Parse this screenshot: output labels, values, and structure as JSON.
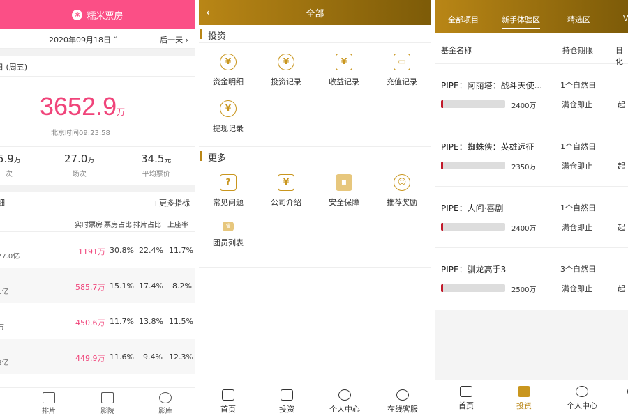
{
  "accent": {
    "pink": "#fb4f86",
    "gold": "#b98616",
    "red": "#c21a2b"
  },
  "p1": {
    "app_title": "糯米票房",
    "logo_icon": "film-reel-icon",
    "date": "2020年09月18日",
    "next_day": "后一天",
    "today_label": "日 (周五)",
    "total_value": "3652.9",
    "total_unit": "万",
    "time": "北京时间09:23:58",
    "stats": [
      {
        "value": "5.9",
        "unit": "万",
        "label": "次"
      },
      {
        "value": "27.0",
        "unit": "万",
        "label": "场次"
      },
      {
        "value": "34.5",
        "unit": "元",
        "label": "平均票价"
      }
    ],
    "detail_title": "细",
    "more_metrics": "+更多指标",
    "table_headers": [
      "实时票房",
      "票房占比",
      "排片占比",
      "上座率"
    ],
    "rows": [
      {
        "total": "27.0亿",
        "box": "1191万",
        "share": "30.8%",
        "sched": "22.4%",
        "seat": "11.7%"
      },
      {
        "total": "1亿",
        "box": "585.7万",
        "share": "15.1%",
        "sched": "17.4%",
        "seat": "8.2%"
      },
      {
        "total": "万",
        "box": "450.6万",
        "share": "11.7%",
        "sched": "13.8%",
        "seat": "11.5%"
      },
      {
        "total": "8亿",
        "box": "449.9万",
        "share": "11.6%",
        "sched": "9.4%",
        "seat": "12.3%"
      }
    ],
    "tabs": [
      {
        "label": "排片",
        "icon": "calendar-icon"
      },
      {
        "label": "影院",
        "icon": "cinema-icon"
      },
      {
        "label": "影库",
        "icon": "film-reel-icon"
      }
    ]
  },
  "p2": {
    "title": "全部",
    "back_icon": "chevron-left-icon",
    "section1": "投资",
    "section1_items": [
      {
        "label": "资金明细",
        "icon": "yen-coin-icon"
      },
      {
        "label": "投资记录",
        "icon": "yen-plus-icon"
      },
      {
        "label": "收益记录",
        "icon": "wallet-icon"
      },
      {
        "label": "充值记录",
        "icon": "card-icon"
      },
      {
        "label": "提现记录",
        "icon": "yen-withdraw-icon"
      }
    ],
    "section2": "更多",
    "section2_items": [
      {
        "label": "常见问题",
        "icon": "question-icon"
      },
      {
        "label": "公司介绍",
        "icon": "house-yen-icon"
      },
      {
        "label": "安全保障",
        "icon": "lock-icon"
      },
      {
        "label": "推荐奖励",
        "icon": "users-icon"
      },
      {
        "label": "团员列表",
        "icon": "crown-icon"
      }
    ],
    "tabs": [
      {
        "label": "首页",
        "icon": "home-icon"
      },
      {
        "label": "投资",
        "icon": "chart-line-icon"
      },
      {
        "label": "个人中心",
        "icon": "user-icon"
      },
      {
        "label": "在线客服",
        "icon": "headset-icon"
      }
    ]
  },
  "p3": {
    "nav": [
      "全部项目",
      "新手体验区",
      "精选区",
      "V"
    ],
    "active_nav": 1,
    "columns": [
      "基金名称",
      "持仓期限",
      "日化"
    ],
    "funds": [
      {
        "name": "PIPE：阿丽塔：战斗天使...",
        "period": "1个自然日",
        "progress": 0.03,
        "amount": "2400万",
        "status": "满仓即止",
        "extra": "起"
      },
      {
        "name": "PIPE：蜘蛛侠：英雄远征",
        "period": "1个自然日",
        "progress": 0.03,
        "amount": "2350万",
        "status": "满仓即止",
        "extra": "起"
      },
      {
        "name": "PIPE：人间·喜剧",
        "period": "1个自然日",
        "progress": 0.03,
        "amount": "2400万",
        "status": "满仓即止",
        "extra": "起"
      },
      {
        "name": "PIPE：驯龙高手3",
        "period": "3个自然日",
        "progress": 0.03,
        "amount": "2500万",
        "status": "满仓即止",
        "extra": "起"
      }
    ],
    "tabs": [
      {
        "label": "首页",
        "icon": "home-icon"
      },
      {
        "label": "投资",
        "icon": "invest-icon"
      },
      {
        "label": "个人中心",
        "icon": "user-icon"
      },
      {
        "label": "在",
        "icon": "headset-icon"
      }
    ]
  }
}
